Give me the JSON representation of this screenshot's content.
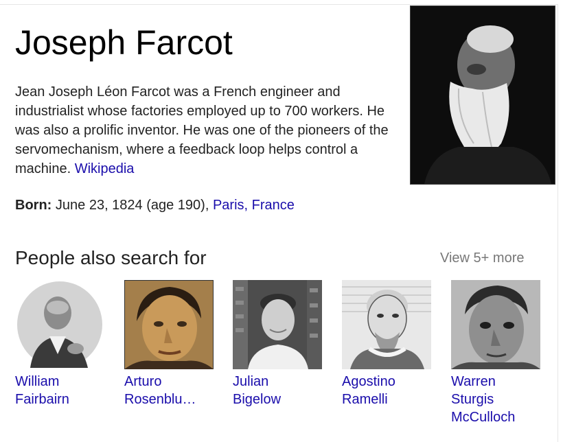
{
  "entity": {
    "title": "Joseph Farcot",
    "description": "Jean Joseph Léon Farcot was a French engineer and industrialist whose factories employed up to 700 workers. He was also a prolific inventor. He was one of the pioneers of the servomechanism, where a feedback loop helps control a machine.",
    "source_link": "Wikipedia",
    "born_label": "Born:",
    "born_value": "June 23, 1824 (age 190),",
    "born_place": "Paris, France"
  },
  "people_also_search": {
    "heading": "People also search for",
    "view_more": "View 5+ more",
    "people": [
      {
        "line1": "William",
        "line2": "Fairbairn",
        "line3": ""
      },
      {
        "line1": "Arturo",
        "line2": "Rosenblu…",
        "line3": ""
      },
      {
        "line1": "Julian",
        "line2": "Bigelow",
        "line3": ""
      },
      {
        "line1": "Agostino",
        "line2": "Ramelli",
        "line3": ""
      },
      {
        "line1": "Warren",
        "line2": "Sturgis",
        "line3": "McCulloch"
      }
    ]
  },
  "colors": {
    "link": "#1a0dab",
    "muted": "#777777",
    "text": "#222222"
  }
}
